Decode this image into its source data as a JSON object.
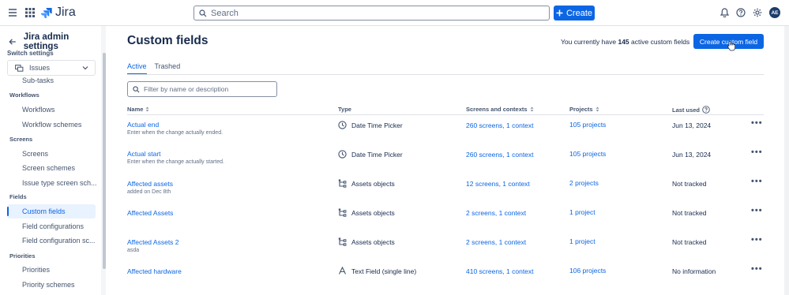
{
  "topbar": {
    "app_name": "Jira",
    "search_placeholder": "Search",
    "create_label": "Create",
    "avatar_initials": "AE"
  },
  "sidebar": {
    "title": "Jira admin settings",
    "switch_label": "Switch settings",
    "switch_value": "Issues",
    "partial_item": "Sub-tasks",
    "sections": [
      {
        "label": "Workflows",
        "items": [
          "Workflows",
          "Workflow schemes"
        ]
      },
      {
        "label": "Screens",
        "items": [
          "Screens",
          "Screen schemes",
          "Issue type screen sch..."
        ]
      },
      {
        "label": "Fields",
        "items": [
          "Custom fields",
          "Field configurations",
          "Field configuration sc..."
        ]
      },
      {
        "label": "Priorities",
        "items": [
          "Priorities",
          "Priority schemes"
        ]
      }
    ],
    "active_item": "Custom fields"
  },
  "main": {
    "title": "Custom fields",
    "count_prefix": "You currently have",
    "count": "145",
    "count_suffix": "active custom fields",
    "create_button": "Create custom field",
    "tabs": [
      {
        "label": "Active",
        "active": true
      },
      {
        "label": "Trashed",
        "active": false
      }
    ],
    "filter_placeholder": "Filter by name or description",
    "columns": {
      "name": "Name",
      "type": "Type",
      "screens": "Screens and contexts",
      "projects": "Projects",
      "last_used": "Last used"
    },
    "rows": [
      {
        "name": "Actual end",
        "desc": "Enter when the change actually ended.",
        "type_icon": "clock-icon",
        "type": "Date Time Picker",
        "screens": "260 screens, 1 context",
        "projects": "105 projects",
        "last_used": "Jun 13, 2024"
      },
      {
        "name": "Actual start",
        "desc": "Enter when the change actually started.",
        "type_icon": "clock-icon",
        "type": "Date Time Picker",
        "screens": "260 screens, 1 context",
        "projects": "105 projects",
        "last_used": "Jun 13, 2024"
      },
      {
        "name": "Affected assets",
        "desc": "added on Dec 8th",
        "type_icon": "assets-icon",
        "type": "Assets objects",
        "screens": "12 screens, 1 context",
        "projects": "2 projects",
        "last_used": "Not tracked"
      },
      {
        "name": "Affected Assets",
        "desc": "",
        "type_icon": "assets-icon",
        "type": "Assets objects",
        "screens": "2 screens, 1 context",
        "projects": "1 project",
        "last_used": "Not tracked"
      },
      {
        "name": "Affected Assets 2",
        "desc": "asda",
        "type_icon": "assets-icon",
        "type": "Assets objects",
        "screens": "2 screens, 1 context",
        "projects": "1 project",
        "last_used": "Not tracked"
      },
      {
        "name": "Affected hardware",
        "desc": "",
        "type_icon": "text-field-icon",
        "type": "Text Field (single line)",
        "screens": "410 screens, 1 context",
        "projects": "106 projects",
        "last_used": "No information"
      }
    ]
  }
}
